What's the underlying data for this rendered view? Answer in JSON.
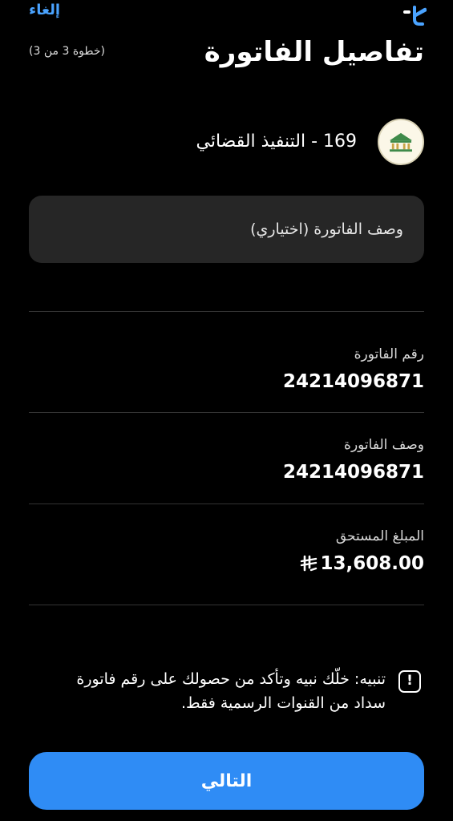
{
  "header": {
    "cancel_label": "إلغاء",
    "title": "تفاصيل الفاتورة",
    "step": "(خطوة 3 من 3)"
  },
  "biller": {
    "name": "169 - التنفيذ القضائي"
  },
  "description_field": {
    "value": "",
    "placeholder": "وصف الفاتورة (اختياري)"
  },
  "details": [
    {
      "label": "رقم الفاتورة",
      "value": "24214096871"
    },
    {
      "label": "وصف الفاتورة",
      "value": "24214096871"
    },
    {
      "label": "المبلغ المستحق",
      "value": "13,608.00",
      "currency_icon": "saudi-riyal-icon"
    }
  ],
  "warning": {
    "icon": "alert-exclamation-icon",
    "text": "تنبيه: خلّك نبيه وتأكد من حصولك على رقم فاتورة سداد من القنوات الرسمية فقط."
  },
  "footer": {
    "next_label": "التالي"
  },
  "colors": {
    "background": "#000000",
    "accent": "#2f8cf5",
    "link": "#4aa3ff",
    "field": "#262626"
  }
}
